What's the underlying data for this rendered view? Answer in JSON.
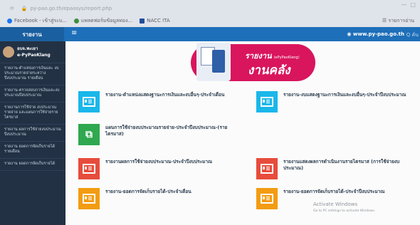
{
  "browser": {
    "url": "py-pao.go.th/epaosys/report.php",
    "tabs": [
      {
        "label": "Facebook - เข้าสู่ระบ...",
        "color": "#1877f2"
      },
      {
        "label": "แพลตฟอร์มข้อมูลทอง...",
        "color": "#3c8f3c"
      },
      {
        "label": "NACC ITA",
        "color": "#1f4e9c"
      }
    ],
    "bookmarks_right": "รายการอ่าน"
  },
  "topbar": {
    "brand": "รายงาน",
    "menu_icon": "hamburger-icon",
    "site": "www.py-pao.go.th",
    "search": "Q ค้น"
  },
  "sidebar": {
    "user_name": "อบจ.พะเยา",
    "user_sub": "e-PyPaoKlang",
    "items": [
      "รายงาน-ตำแหน่งการเงินและ งบประมาณรายจ่ายระหว่างปีงบประมาณ รายเดือน",
      "รายงาน-ตรวจสอบการเงินและงบประมาณปีงบประมาณ",
      "รายงานการใช้จ่าย งบประมาณรายจ่าย และแผนการใช้จ่ายรายไตรมาส",
      "รายงาน ผลการใช้จ่ายงบประมาณ ปีงบประมาณ",
      "รายงาน ยอดการจัดเก็บรายได้ รายเดือน",
      "รายงาน ยอดการจัดเก็บรายได้"
    ]
  },
  "banner": {
    "title": "รายงาน",
    "title_small": "(ePyPaoKlang)",
    "subtitle": "งานคลัง"
  },
  "cards": [
    {
      "label": "รายงาน-ตำแหน่งแสดงฐานะการเงินและงบอื่นๆ-ประจำเดือน",
      "color": "#1ab7ea",
      "icon": "document-icon"
    },
    {
      "label": "รายงาน-งบแสดงฐานะการเงินและงบอื่นๆ-ประจำปีงบประมาณ",
      "color": "#1ab7ea",
      "icon": "document-icon"
    },
    {
      "label": "แผนการใช้จ่ายงบประมาณรายจ่าย-ประจำปีงบประมาณ-(รายไตรมาส)",
      "color": "#2fa84f",
      "icon": "copy-icon"
    },
    {
      "label": "รายงานผลการใช้จ่ายงบประมาณ-ประจำปีงบประมาณ",
      "color": "#e74c3c",
      "icon": "document-icon"
    },
    {
      "label": "รายงานแสดงผลการดำเนินงานรายไตรมาส (การใช้จ่ายงบประมาณ)",
      "color": "#e74c3c",
      "icon": "document-icon"
    },
    {
      "label": "รายงาน-ยอดการจัดเก็บรายได้-ประจำเดือน",
      "color": "#f39c12",
      "icon": "document-icon"
    },
    {
      "label": "รายงาน-ยอดการจัดเก็บรายได้-ประจำปีงบประมาณ",
      "color": "#f39c12",
      "icon": "document-icon"
    }
  ],
  "watermark": {
    "title": "Activate Windows",
    "sub": "Go to PC settings to activate Windows."
  }
}
